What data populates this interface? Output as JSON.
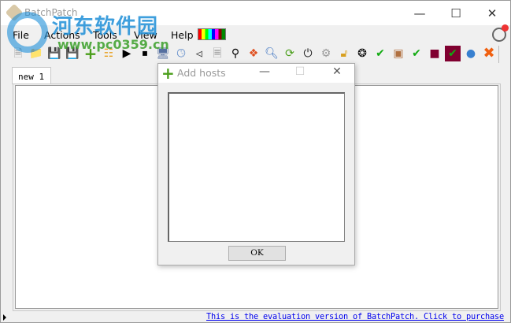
{
  "window": {
    "title": "BatchPatch",
    "controls": [
      "minimize",
      "maximize",
      "close"
    ]
  },
  "watermark": {
    "name": "河东软件园",
    "url": "www.pc0359.cn"
  },
  "menu": [
    "File",
    "Actions",
    "Tools",
    "View",
    "Help"
  ],
  "toolbar": [
    "new",
    "open",
    "save",
    "save-all",
    "add-hosts",
    "add-group",
    "start",
    "stop",
    "remote-computer",
    "schedule",
    "disk",
    "settings-document",
    "map-pin",
    "deploy",
    "search",
    "refresh",
    "power",
    "gear",
    "unlock",
    "wheel",
    "wheel-check",
    "package",
    "package-check",
    "terminal",
    "terminal-check",
    "globe",
    "remove"
  ],
  "tabs": [
    {
      "label": "new 1"
    }
  ],
  "status": {
    "eval_text": "This is the evaluation version of BatchPatch.  Click to purchase"
  },
  "dialog": {
    "title": "Add hosts",
    "ok_label": "OK",
    "hosts_value": ""
  }
}
